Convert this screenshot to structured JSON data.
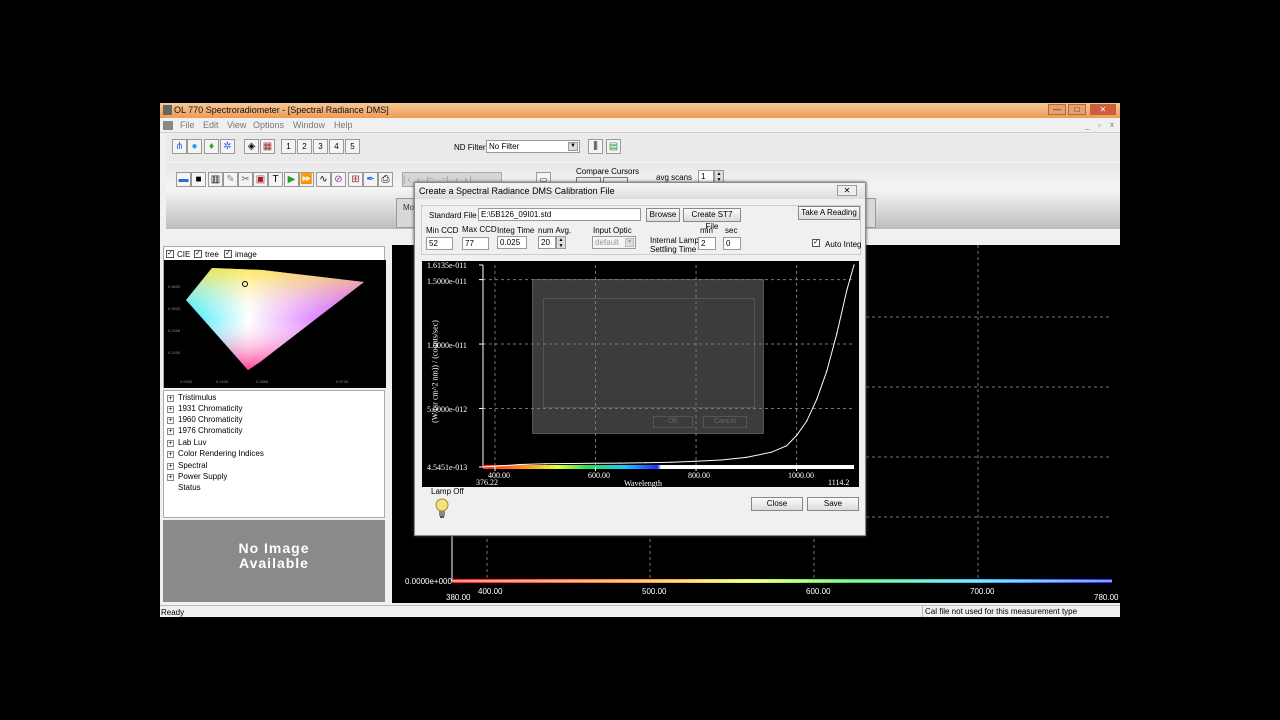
{
  "window": {
    "title": "OL 770 Spectroradiometer - [Spectral Radiance DMS]",
    "min_glyph": "—",
    "max_glyph": "□",
    "close_glyph": "✕"
  },
  "menu": [
    "File",
    "Edit",
    "View",
    "Options",
    "Window",
    "Help"
  ],
  "toolbar": {
    "number_buttons": [
      "1",
      "2",
      "3",
      "4",
      "5"
    ],
    "nd_filter_label": "ND Filter",
    "nd_filter_value": "No Filter",
    "compare_cursors_label": "Compare Cursors",
    "avg_scans_label": "avg scans",
    "avg_scans_value": "1"
  },
  "left_panel": {
    "checks": [
      {
        "label": "CIE",
        "checked": true
      },
      {
        "label": "tree",
        "checked": true
      },
      {
        "label": "image",
        "checked": true
      }
    ],
    "tree": [
      {
        "label": "Tristimulus",
        "expandable": true
      },
      {
        "label": "1931 Chromaticity",
        "expandable": true
      },
      {
        "label": "1960 Chromaticity",
        "expandable": true
      },
      {
        "label": "1976 Chromaticity",
        "expandable": true
      },
      {
        "label": "Lab Luv",
        "expandable": true
      },
      {
        "label": "Color Rendering Indices",
        "expandable": true
      },
      {
        "label": "Spectral",
        "expandable": true
      },
      {
        "label": "Power Supply",
        "expandable": true
      },
      {
        "label": "Status",
        "expandable": false
      }
    ],
    "no_image_line1": "No Image",
    "no_image_line2": "Available"
  },
  "main_plot": {
    "y_label": "0.0000e+000",
    "x_start": "380.00",
    "x_end": "780.00",
    "x_ticks": [
      "400.00",
      "500.00",
      "600.00",
      "700.00"
    ]
  },
  "status": {
    "left": "Ready",
    "right": "Cal file not used for this measurement type"
  },
  "dialog": {
    "title": "Create a Spectral Radiance DMS Calibration File",
    "close_glyph": "✕",
    "standard_file_label": "Standard File",
    "standard_file_value": "E:\\5B126_09I01.std",
    "browse_label": "Browse",
    "create_st7_label": "Create ST7 File",
    "take_reading_label": "Take A Reading",
    "min_ccd_label": "Min CCD",
    "min_ccd_value": "52",
    "max_ccd_label": "Max CCD",
    "max_ccd_value": "77",
    "integ_time_label": "Integ Time",
    "integ_time_value": "0.025",
    "num_avg_label": "num Avg.",
    "num_avg_value": "20",
    "input_optic_label": "Input Optic",
    "input_optic_value": "default",
    "lamp_settling_label1": "Internal Lamp",
    "lamp_settling_label2": "Settling Time",
    "min_label": "min",
    "sec_label": "sec",
    "min_value": "2",
    "sec_value": "0",
    "auto_integ_label": "Auto Integ",
    "lamp_status": "Lamp Off",
    "close_btn": "Close",
    "save_btn": "Save",
    "ghost_ok": "OK",
    "ghost_cancel": "Cancel"
  },
  "chart_data": {
    "type": "line",
    "x": [
      376.22,
      450,
      500,
      550,
      600,
      650,
      700,
      750,
      800,
      850,
      900,
      950,
      980,
      1000,
      1020,
      1040,
      1060,
      1080,
      1100,
      1114.2
    ],
    "y": [
      4.5451e-13,
      6.5e-13,
      7e-13,
      7.3e-13,
      7.5e-13,
      7.6e-13,
      7.9e-13,
      8.3e-13,
      9e-13,
      1e-12,
      1.2e-12,
      1.6e-12,
      2.1e-12,
      2.9e-12,
      4e-12,
      5.7e-12,
      7.9e-12,
      1.08e-11,
      1.42e-11,
      1.6135e-11
    ],
    "xlim": [
      376.22,
      1114.2
    ],
    "ylim": [
      4.5451e-13,
      1.6135e-11
    ],
    "y_tick_labels": [
      "1.6135e-011",
      "1.5000e-011",
      "1.0000e-011",
      "5.0000e-012",
      "4.5451e-013"
    ],
    "x_tick_labels": [
      "400.00",
      "600.00",
      "800.00",
      "1000.00"
    ],
    "x_end_labels": [
      "376.22",
      "1114.2"
    ],
    "xlabel": "Wavelength",
    "ylabel": "(W/(sr cm^2 nm)) / (counts/sec)",
    "grid": true
  }
}
